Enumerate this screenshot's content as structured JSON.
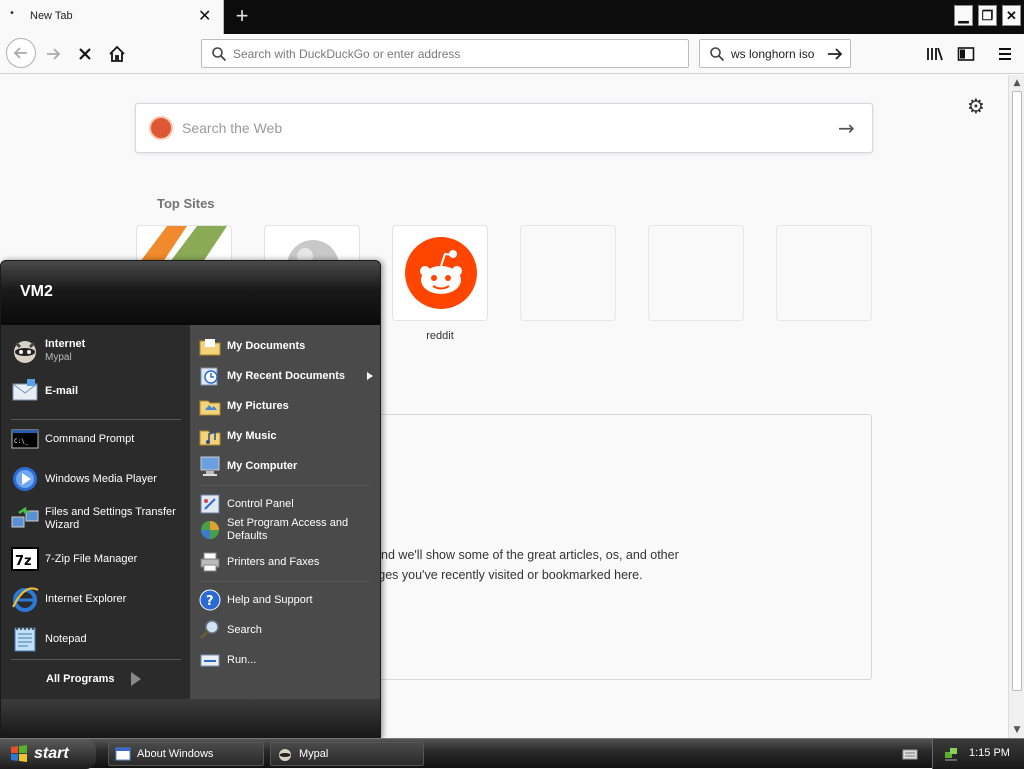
{
  "browser": {
    "tab_title": "New Tab",
    "tab_dot": "•",
    "tab_close": "✕",
    "new_tab": "+",
    "window_buttons": [
      "▁",
      "❐",
      "✕"
    ],
    "url_placeholder": "Search with DuckDuckGo or enter address",
    "search_value": "ws longhorn iso"
  },
  "newtab": {
    "search_placeholder": "Search the Web",
    "top_sites_title": "Top Sites",
    "tiles": [
      {
        "label": ""
      },
      {
        "label": ""
      },
      {
        "label": "reddit"
      },
      {
        "label": ""
      },
      {
        "label": ""
      },
      {
        "label": ""
      }
    ],
    "highlights_message": "owsing, and we'll show some of the great articles, os, and other pages you've recently visited or bookmarked here."
  },
  "start_menu": {
    "user": "VM2",
    "pinned": [
      {
        "label": "Internet",
        "sub": "Mypal"
      },
      {
        "label": "E-mail",
        "sub": ""
      }
    ],
    "recent": [
      {
        "label": "Command Prompt"
      },
      {
        "label": "Windows Media Player"
      },
      {
        "label": "Files and Settings Transfer Wizard"
      },
      {
        "label": "7-Zip File Manager"
      },
      {
        "label": "Internet Explorer"
      },
      {
        "label": "Notepad"
      }
    ],
    "all_programs": "All Programs",
    "right": [
      {
        "label": "My Documents"
      },
      {
        "label": "My Recent Documents"
      },
      {
        "label": "My Pictures"
      },
      {
        "label": "My Music"
      },
      {
        "label": "My Computer"
      },
      {
        "label": "Control Panel"
      },
      {
        "label": "Set Program Access and Defaults"
      },
      {
        "label": "Printers and Faxes"
      },
      {
        "label": "Help and Support"
      },
      {
        "label": "Search"
      },
      {
        "label": "Run..."
      }
    ]
  },
  "taskbar": {
    "start_label": "start",
    "tasks": [
      {
        "label": "About Windows"
      },
      {
        "label": "Mypal"
      }
    ],
    "clock": "1:15 PM"
  },
  "colors": {
    "reddit": "#ff4500",
    "ddg": "#de5833",
    "firefox_dark": "#0c0c0d"
  }
}
